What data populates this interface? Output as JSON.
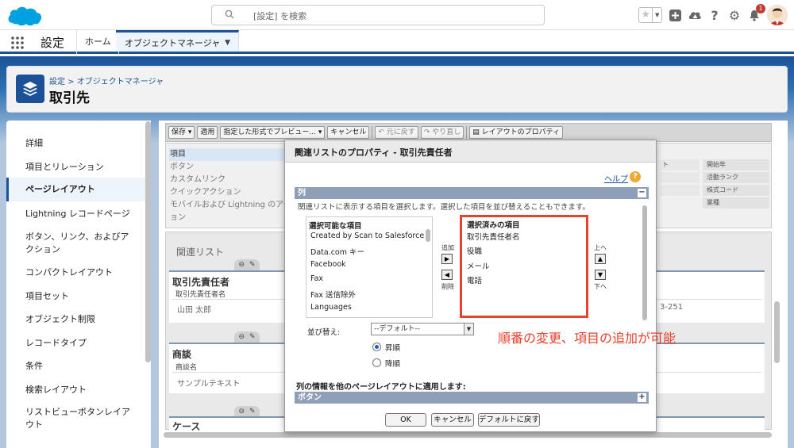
{
  "search": {
    "placeholder": "[設定] を検索"
  },
  "header_icons": {
    "notification_count": "1"
  },
  "nav": {
    "app_name": "設定",
    "tabs": [
      {
        "label": "ホーム"
      },
      {
        "label": "オブジェクトマネージャ"
      }
    ]
  },
  "page": {
    "breadcrumb": "設定 > オブジェクトマネージャ",
    "title": "取引先"
  },
  "sidebar": {
    "items": [
      {
        "label": "詳細"
      },
      {
        "label": "項目とリレーション"
      },
      {
        "label": "ページレイアウト"
      },
      {
        "label": "Lightning レコードページ"
      },
      {
        "label": "ボタン、リンク、およびアクション"
      },
      {
        "label": "コンパクトレイアウト"
      },
      {
        "label": "項目セット"
      },
      {
        "label": "オブジェクト制限"
      },
      {
        "label": "レコードタイプ"
      },
      {
        "label": "条件"
      },
      {
        "label": "検索レイアウト"
      },
      {
        "label": "リストビューボタンレイアウト"
      }
    ]
  },
  "toolbar": {
    "save": "保存 ▾",
    "apply": "適用",
    "preview": "指定した形式でプレビュー... ▾",
    "cancel": "キャンセル",
    "undo": "元に戻す",
    "redo": "やり直し",
    "layout_props": "レイアウトのプロパティ"
  },
  "palette": {
    "items": [
      "項目",
      "ボタン",
      "カスタムリンク",
      "クイックアクション",
      "モバイルおよび Lightning のアクシ",
      "ョン"
    ],
    "right_items": [
      "開始年",
      "活動ランク",
      "株式コード",
      "業種"
    ]
  },
  "canvas": {
    "related_list_title": "関連リスト",
    "sections": [
      {
        "title": "取引先責任者",
        "column": "取引先責任者名",
        "value": "山田 太郎",
        "right_value": "3-251"
      },
      {
        "title": "商談",
        "column": "商談名",
        "value": "サンプルテキスト"
      },
      {
        "title": "ケース"
      }
    ]
  },
  "modal": {
    "title": "関連リストのプロパティ - 取引先責任者",
    "help": "ヘルプ",
    "columns_bar": "列",
    "description": "関連リストに表示する項目を選択します。選択した項目を並び替えることもできます。",
    "available_label": "選択可能な項目",
    "available": [
      "Created by Scan to Salesforce",
      "Data.com キー",
      "Facebook",
      "Fax",
      "Fax 送信除外",
      "Languages"
    ],
    "add_label": "追加",
    "remove_label": "削除",
    "selected_label": "選択済みの項目",
    "selected": [
      "取引先責任者名",
      "役職",
      "メール",
      "電話"
    ],
    "up_label": "上へ",
    "down_label": "下へ",
    "sort_label": "並び替え:",
    "sort_value": "--デフォルト--",
    "asc": "昇順",
    "desc": "降順",
    "apply_text": "列の情報を他のページレイアウトに適用します:",
    "buttons_bar": "ボタン",
    "ok": "OK",
    "cancel": "キャンセル",
    "default": "デフォルトに戻す"
  },
  "annotation": "順番の変更、項目の追加が可能",
  "colors": {
    "brand_blue": "#1b5297",
    "annotation_red": "#e8412c",
    "salesforce_cloud": "#00a1e0"
  }
}
